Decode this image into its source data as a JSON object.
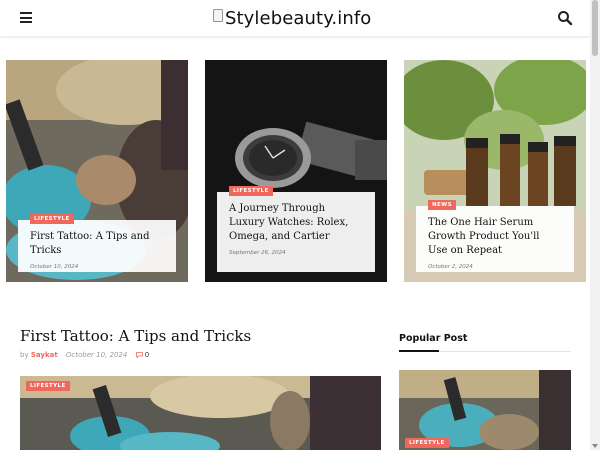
{
  "header": {
    "logo_text": "Stylebeauty.info",
    "menu_icon": "hamburger-menu-icon",
    "search_icon": "search-icon"
  },
  "hero_posts": [
    {
      "category": "LIFESTYLE",
      "title": "First Tattoo: A Tips and Tricks",
      "date": "October 10, 2024"
    },
    {
      "category": "LIFESTYLE",
      "title": "A Journey Through Luxury Watches: Rolex, Omega, and Cartier",
      "date": "September 26, 2024"
    },
    {
      "category": "NEWS",
      "title": "The One Hair Serum Growth Product You'll Use on Repeat",
      "date": "October 2, 2024"
    }
  ],
  "main_post": {
    "title": "First Tattoo: A Tips and Tricks",
    "by": "by",
    "author": "Saykat",
    "date": "October 10, 2024",
    "comment_count": "0",
    "category": "LIFESTYLE"
  },
  "sidebar": {
    "heading": "Popular Post",
    "post_category": "LIFESTYLE"
  },
  "colors": {
    "accent": "#f0685b",
    "text": "#111111",
    "muted": "#999999"
  }
}
